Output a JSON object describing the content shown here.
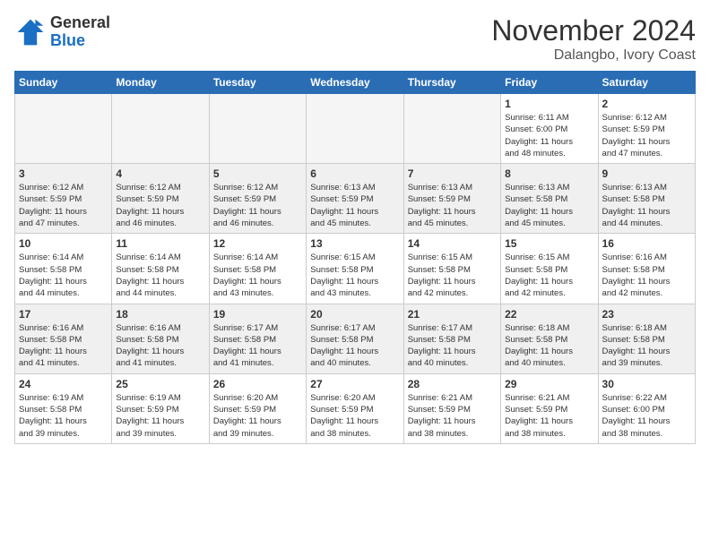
{
  "header": {
    "logo_general": "General",
    "logo_blue": "Blue",
    "month": "November 2024",
    "location": "Dalangbo, Ivory Coast"
  },
  "days_of_week": [
    "Sunday",
    "Monday",
    "Tuesday",
    "Wednesday",
    "Thursday",
    "Friday",
    "Saturday"
  ],
  "weeks": [
    [
      {
        "day": "",
        "info": "",
        "empty": true
      },
      {
        "day": "",
        "info": "",
        "empty": true
      },
      {
        "day": "",
        "info": "",
        "empty": true
      },
      {
        "day": "",
        "info": "",
        "empty": true
      },
      {
        "day": "",
        "info": "",
        "empty": true
      },
      {
        "day": "1",
        "info": "Sunrise: 6:11 AM\nSunset: 6:00 PM\nDaylight: 11 hours\nand 48 minutes."
      },
      {
        "day": "2",
        "info": "Sunrise: 6:12 AM\nSunset: 5:59 PM\nDaylight: 11 hours\nand 47 minutes."
      }
    ],
    [
      {
        "day": "3",
        "info": "Sunrise: 6:12 AM\nSunset: 5:59 PM\nDaylight: 11 hours\nand 47 minutes."
      },
      {
        "day": "4",
        "info": "Sunrise: 6:12 AM\nSunset: 5:59 PM\nDaylight: 11 hours\nand 46 minutes."
      },
      {
        "day": "5",
        "info": "Sunrise: 6:12 AM\nSunset: 5:59 PM\nDaylight: 11 hours\nand 46 minutes."
      },
      {
        "day": "6",
        "info": "Sunrise: 6:13 AM\nSunset: 5:59 PM\nDaylight: 11 hours\nand 45 minutes."
      },
      {
        "day": "7",
        "info": "Sunrise: 6:13 AM\nSunset: 5:59 PM\nDaylight: 11 hours\nand 45 minutes."
      },
      {
        "day": "8",
        "info": "Sunrise: 6:13 AM\nSunset: 5:58 PM\nDaylight: 11 hours\nand 45 minutes."
      },
      {
        "day": "9",
        "info": "Sunrise: 6:13 AM\nSunset: 5:58 PM\nDaylight: 11 hours\nand 44 minutes."
      }
    ],
    [
      {
        "day": "10",
        "info": "Sunrise: 6:14 AM\nSunset: 5:58 PM\nDaylight: 11 hours\nand 44 minutes."
      },
      {
        "day": "11",
        "info": "Sunrise: 6:14 AM\nSunset: 5:58 PM\nDaylight: 11 hours\nand 44 minutes."
      },
      {
        "day": "12",
        "info": "Sunrise: 6:14 AM\nSunset: 5:58 PM\nDaylight: 11 hours\nand 43 minutes."
      },
      {
        "day": "13",
        "info": "Sunrise: 6:15 AM\nSunset: 5:58 PM\nDaylight: 11 hours\nand 43 minutes."
      },
      {
        "day": "14",
        "info": "Sunrise: 6:15 AM\nSunset: 5:58 PM\nDaylight: 11 hours\nand 42 minutes."
      },
      {
        "day": "15",
        "info": "Sunrise: 6:15 AM\nSunset: 5:58 PM\nDaylight: 11 hours\nand 42 minutes."
      },
      {
        "day": "16",
        "info": "Sunrise: 6:16 AM\nSunset: 5:58 PM\nDaylight: 11 hours\nand 42 minutes."
      }
    ],
    [
      {
        "day": "17",
        "info": "Sunrise: 6:16 AM\nSunset: 5:58 PM\nDaylight: 11 hours\nand 41 minutes."
      },
      {
        "day": "18",
        "info": "Sunrise: 6:16 AM\nSunset: 5:58 PM\nDaylight: 11 hours\nand 41 minutes."
      },
      {
        "day": "19",
        "info": "Sunrise: 6:17 AM\nSunset: 5:58 PM\nDaylight: 11 hours\nand 41 minutes."
      },
      {
        "day": "20",
        "info": "Sunrise: 6:17 AM\nSunset: 5:58 PM\nDaylight: 11 hours\nand 40 minutes."
      },
      {
        "day": "21",
        "info": "Sunrise: 6:17 AM\nSunset: 5:58 PM\nDaylight: 11 hours\nand 40 minutes."
      },
      {
        "day": "22",
        "info": "Sunrise: 6:18 AM\nSunset: 5:58 PM\nDaylight: 11 hours\nand 40 minutes."
      },
      {
        "day": "23",
        "info": "Sunrise: 6:18 AM\nSunset: 5:58 PM\nDaylight: 11 hours\nand 39 minutes."
      }
    ],
    [
      {
        "day": "24",
        "info": "Sunrise: 6:19 AM\nSunset: 5:58 PM\nDaylight: 11 hours\nand 39 minutes."
      },
      {
        "day": "25",
        "info": "Sunrise: 6:19 AM\nSunset: 5:59 PM\nDaylight: 11 hours\nand 39 minutes."
      },
      {
        "day": "26",
        "info": "Sunrise: 6:20 AM\nSunset: 5:59 PM\nDaylight: 11 hours\nand 39 minutes."
      },
      {
        "day": "27",
        "info": "Sunrise: 6:20 AM\nSunset: 5:59 PM\nDaylight: 11 hours\nand 38 minutes."
      },
      {
        "day": "28",
        "info": "Sunrise: 6:21 AM\nSunset: 5:59 PM\nDaylight: 11 hours\nand 38 minutes."
      },
      {
        "day": "29",
        "info": "Sunrise: 6:21 AM\nSunset: 5:59 PM\nDaylight: 11 hours\nand 38 minutes."
      },
      {
        "day": "30",
        "info": "Sunrise: 6:22 AM\nSunset: 6:00 PM\nDaylight: 11 hours\nand 38 minutes."
      }
    ]
  ]
}
